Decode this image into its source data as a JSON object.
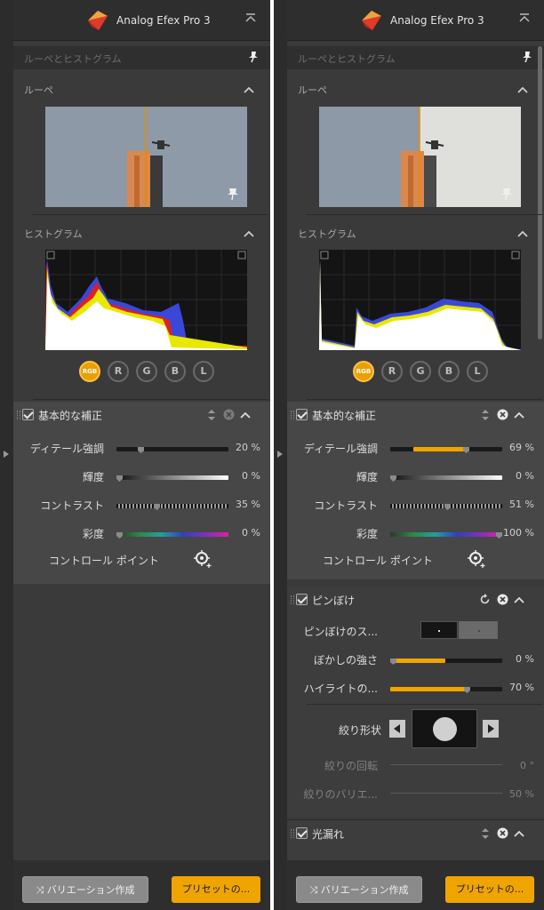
{
  "app": {
    "title": "Analog Efex Pro 3"
  },
  "loupe_histogram": {
    "section_title": "ルーペとヒストグラム",
    "loupe_title": "ルーペ",
    "histogram_title": "ヒストグラム"
  },
  "channels": [
    "RGB",
    "R",
    "G",
    "B",
    "L"
  ],
  "basic": {
    "title": "基本的な補正",
    "labels": [
      "ディテール強調",
      "輝度",
      "コントラスト",
      "彩度"
    ],
    "control_points": "コントロール ポイント"
  },
  "panels": [
    {
      "basic_values": [
        "20 %",
        "0 %",
        "35 %",
        "0 %"
      ],
      "levels": [
        0.2,
        0.0,
        0.35,
        0.0
      ]
    },
    {
      "basic_values": [
        "69 %",
        "0 %",
        "51 %",
        "100 %"
      ],
      "levels": [
        0.69,
        0.0,
        0.51,
        1.0
      ]
    }
  ],
  "bokeh": {
    "title": "ピンぼけ",
    "labels": [
      "ピンぼけのス...",
      "ぼかしの強さ",
      "ハイライトの..."
    ],
    "values": [
      "0 %",
      "70 %"
    ],
    "levels": [
      0.0,
      0.7
    ],
    "aperture_label": "絞り形状",
    "aperture_rotation_label": "絞りの回転",
    "aperture_rotation_value": "0 °",
    "aperture_variation_label": "絞りのバリエ...",
    "aperture_variation_value": "50 %"
  },
  "light_leaks": {
    "title": "光漏れ"
  },
  "footer": {
    "variations": "バリエーション作成",
    "presets": "プリセットの..."
  },
  "colors": {
    "accent": "#f0a400",
    "panel_bg": "#3a3a3a",
    "module_bg": "#474747"
  }
}
